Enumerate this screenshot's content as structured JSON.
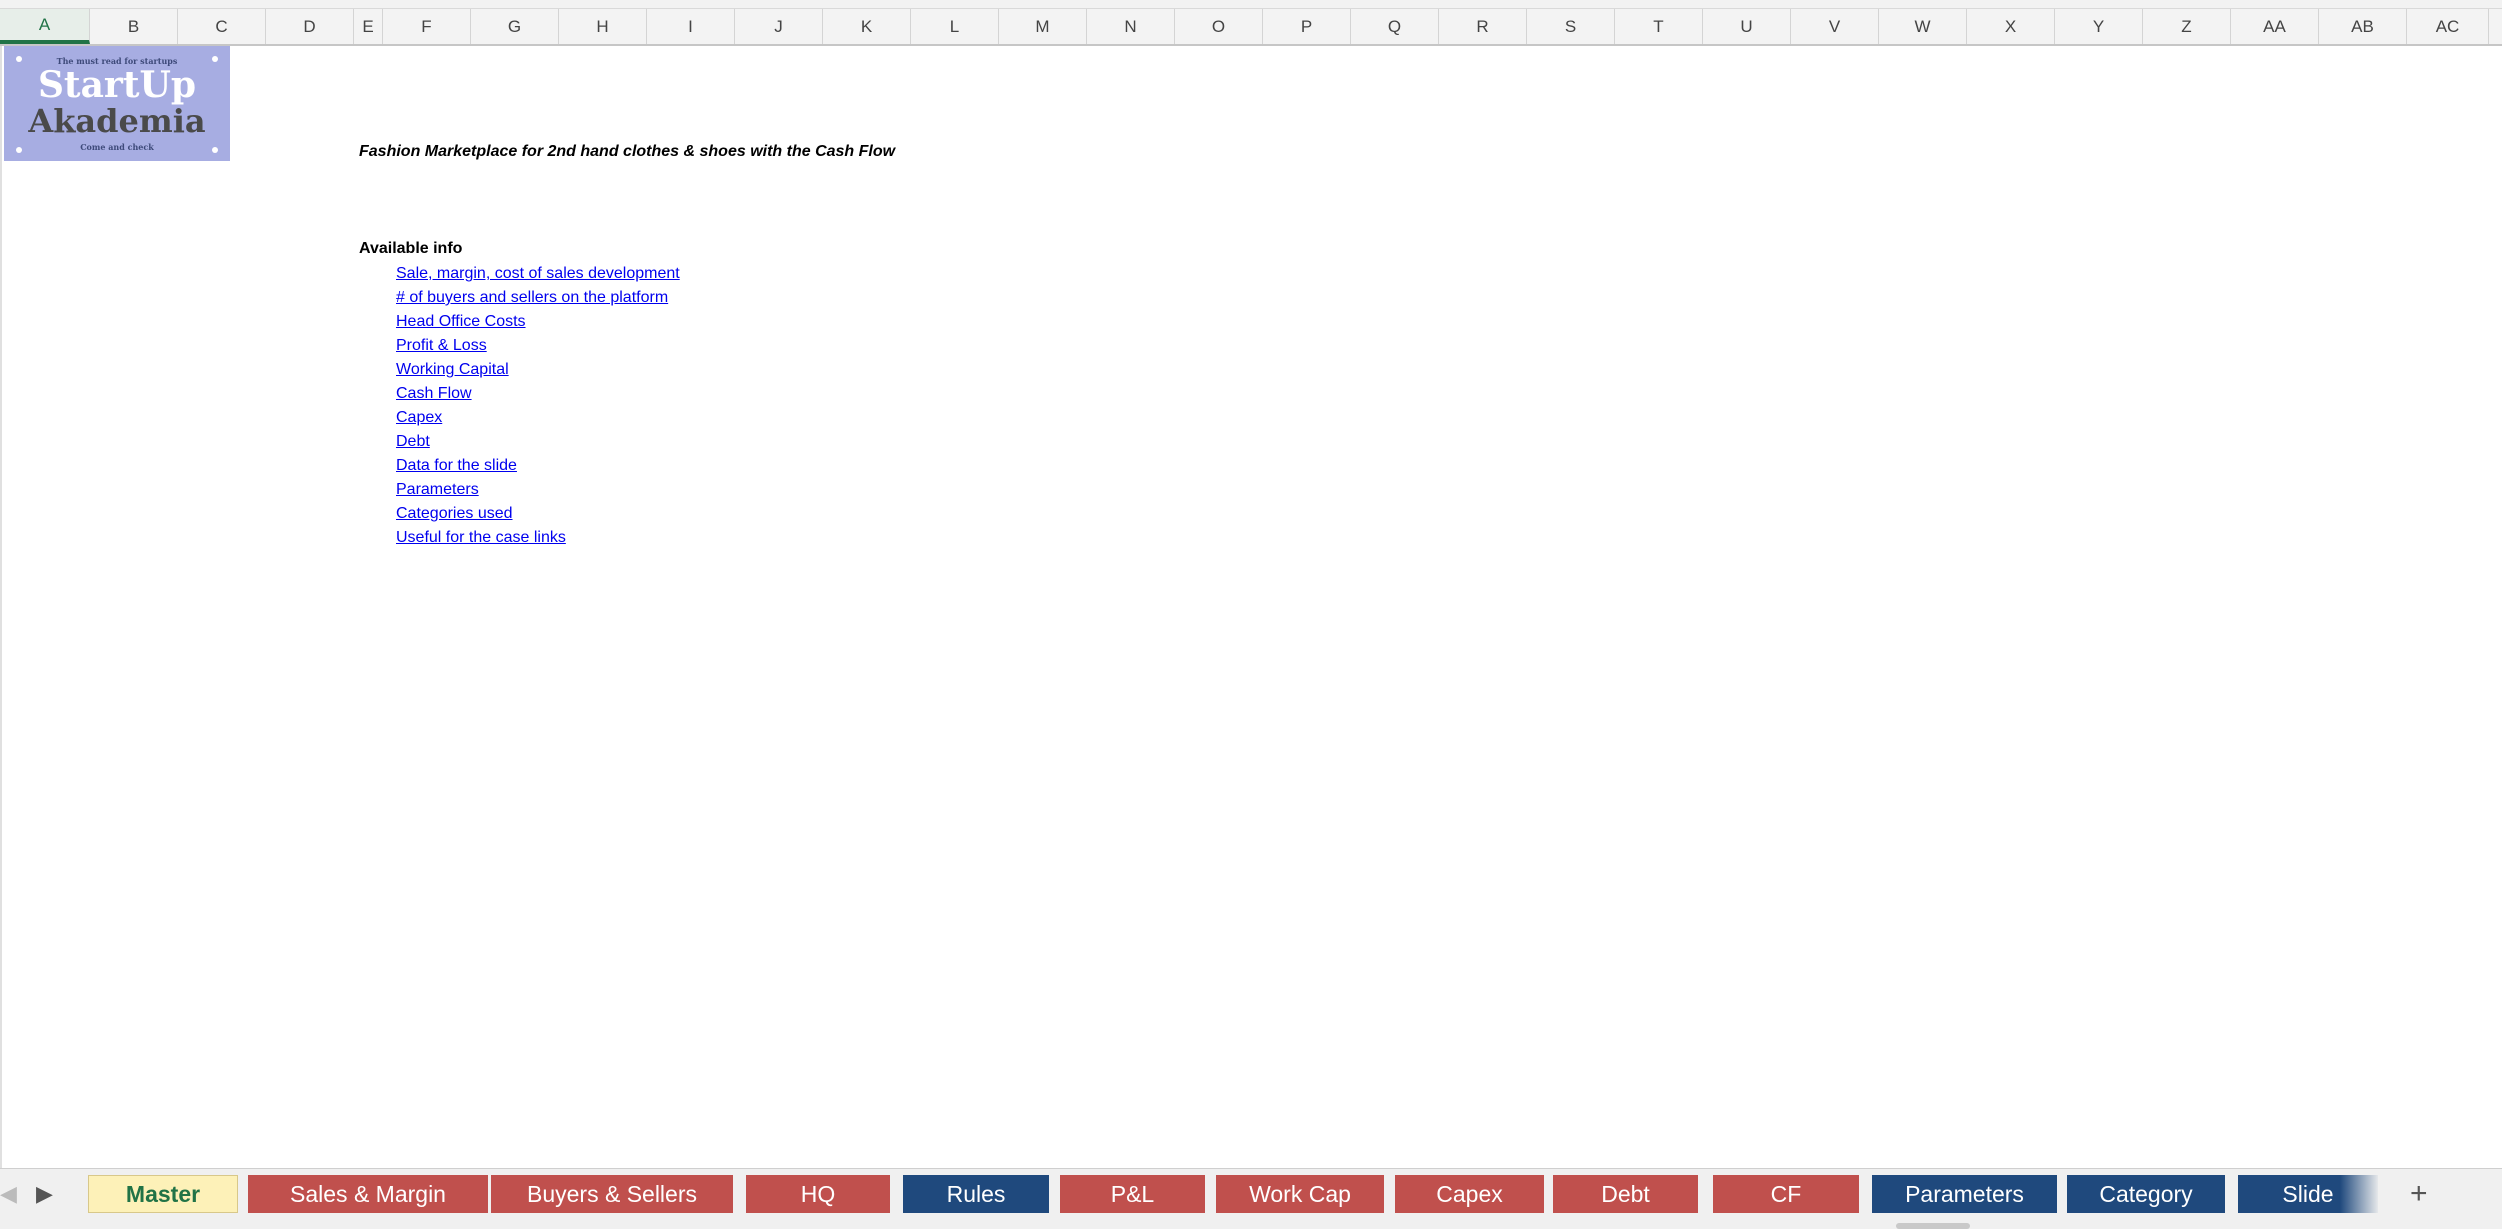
{
  "columns": [
    "A",
    "B",
    "C",
    "D",
    "E",
    "F",
    "G",
    "H",
    "I",
    "J",
    "K",
    "L",
    "M",
    "N",
    "O",
    "P",
    "Q",
    "R",
    "S",
    "T",
    "U",
    "V",
    "W",
    "X",
    "Y",
    "Z",
    "AA",
    "AB",
    "AC"
  ],
  "logo": {
    "tagline": "The must read for startups",
    "line1": "StartUp",
    "line2": "Akademia",
    "bottom": "Come and check"
  },
  "title": "Fashion Marketplace for 2nd hand clothes & shoes with the Cash Flow",
  "info_heading": "Available info",
  "links": [
    "Sale, margin, cost of sales development",
    "# of buyers and sellers on the platform",
    "Head Office Costs",
    "Profit & Loss",
    "Working Capital",
    "Cash Flow",
    "Capex",
    "Debt",
    "Data for the slide",
    "Parameters",
    "Categories used",
    "Useful for the case links"
  ],
  "tabs": [
    {
      "label": "Master",
      "color": "active"
    },
    {
      "label": "Sales & Margin",
      "color": "red"
    },
    {
      "label": "Buyers & Sellers",
      "color": "red"
    },
    {
      "label": "HQ",
      "color": "red"
    },
    {
      "label": "Rules",
      "color": "blue"
    },
    {
      "label": "P&L",
      "color": "red"
    },
    {
      "label": "Work Cap",
      "color": "red"
    },
    {
      "label": "Capex",
      "color": "red"
    },
    {
      "label": "Debt",
      "color": "red"
    },
    {
      "label": "CF",
      "color": "red"
    },
    {
      "label": "Parameters",
      "color": "blue"
    },
    {
      "label": "Category",
      "color": "blue"
    },
    {
      "label": "Slide",
      "color": "blue"
    }
  ],
  "colors": {
    "red_tab": "#c0504d",
    "blue_tab": "#1f497d",
    "active_tab": "#fdf1b8",
    "link": "#0000ee",
    "logo_bg": "#a7ade2",
    "excel_green": "#217346"
  },
  "icons": {
    "prev": "chevron-left-icon",
    "next": "chevron-right-icon",
    "add": "plus-icon"
  }
}
